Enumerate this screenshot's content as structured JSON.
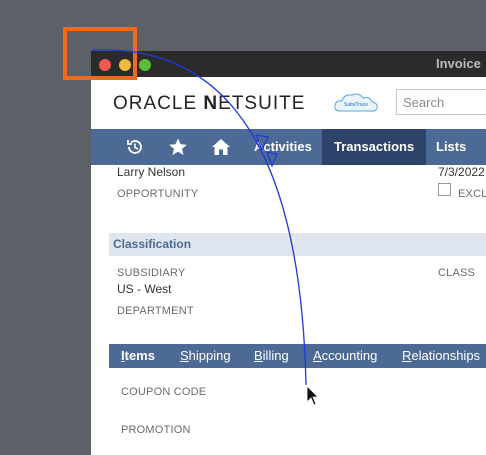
{
  "window": {
    "title": "Invoice"
  },
  "brand": {
    "logo_prefix": "ORACLE ",
    "logo_n": "N",
    "logo_suffix": "ETSUITE",
    "cloud_text": "SuiteTrace"
  },
  "search": {
    "placeholder": "Search"
  },
  "nav": {
    "icons": [
      "history-icon",
      "star-icon",
      "home-icon"
    ],
    "items": [
      {
        "label": "Activities",
        "active": false
      },
      {
        "label": "Transactions",
        "active": true
      },
      {
        "label": "Lists",
        "active": false
      }
    ]
  },
  "fields": {
    "customer_value": "Larry Nelson",
    "date_value": "7/3/2022",
    "opportunity_label": "OPPORTUNITY",
    "exclude_label": "EXCLU",
    "classification_title": "Classification",
    "subsidiary_label": "SUBSIDIARY",
    "subsidiary_value": "US - West",
    "class_label": "CLASS",
    "department_label": "DEPARTMENT"
  },
  "subtabs": [
    {
      "key": "I",
      "rest": "tems",
      "active": true
    },
    {
      "key": "S",
      "rest": "hipping",
      "active": false
    },
    {
      "key": "B",
      "rest": "illing",
      "active": false
    },
    {
      "key": "A",
      "rest": "ccounting",
      "active": false
    },
    {
      "key": "R",
      "rest": "elationships",
      "active": false
    }
  ],
  "items_tab": {
    "coupon_label": "COUPON CODE",
    "promotion_label": "PROMOTION"
  },
  "colors": {
    "nav": "#4c6a95",
    "nav_active": "#2d4369",
    "section": "#e0e6ef",
    "highlight": "#f06a1b",
    "path": "#1d3ad9"
  }
}
